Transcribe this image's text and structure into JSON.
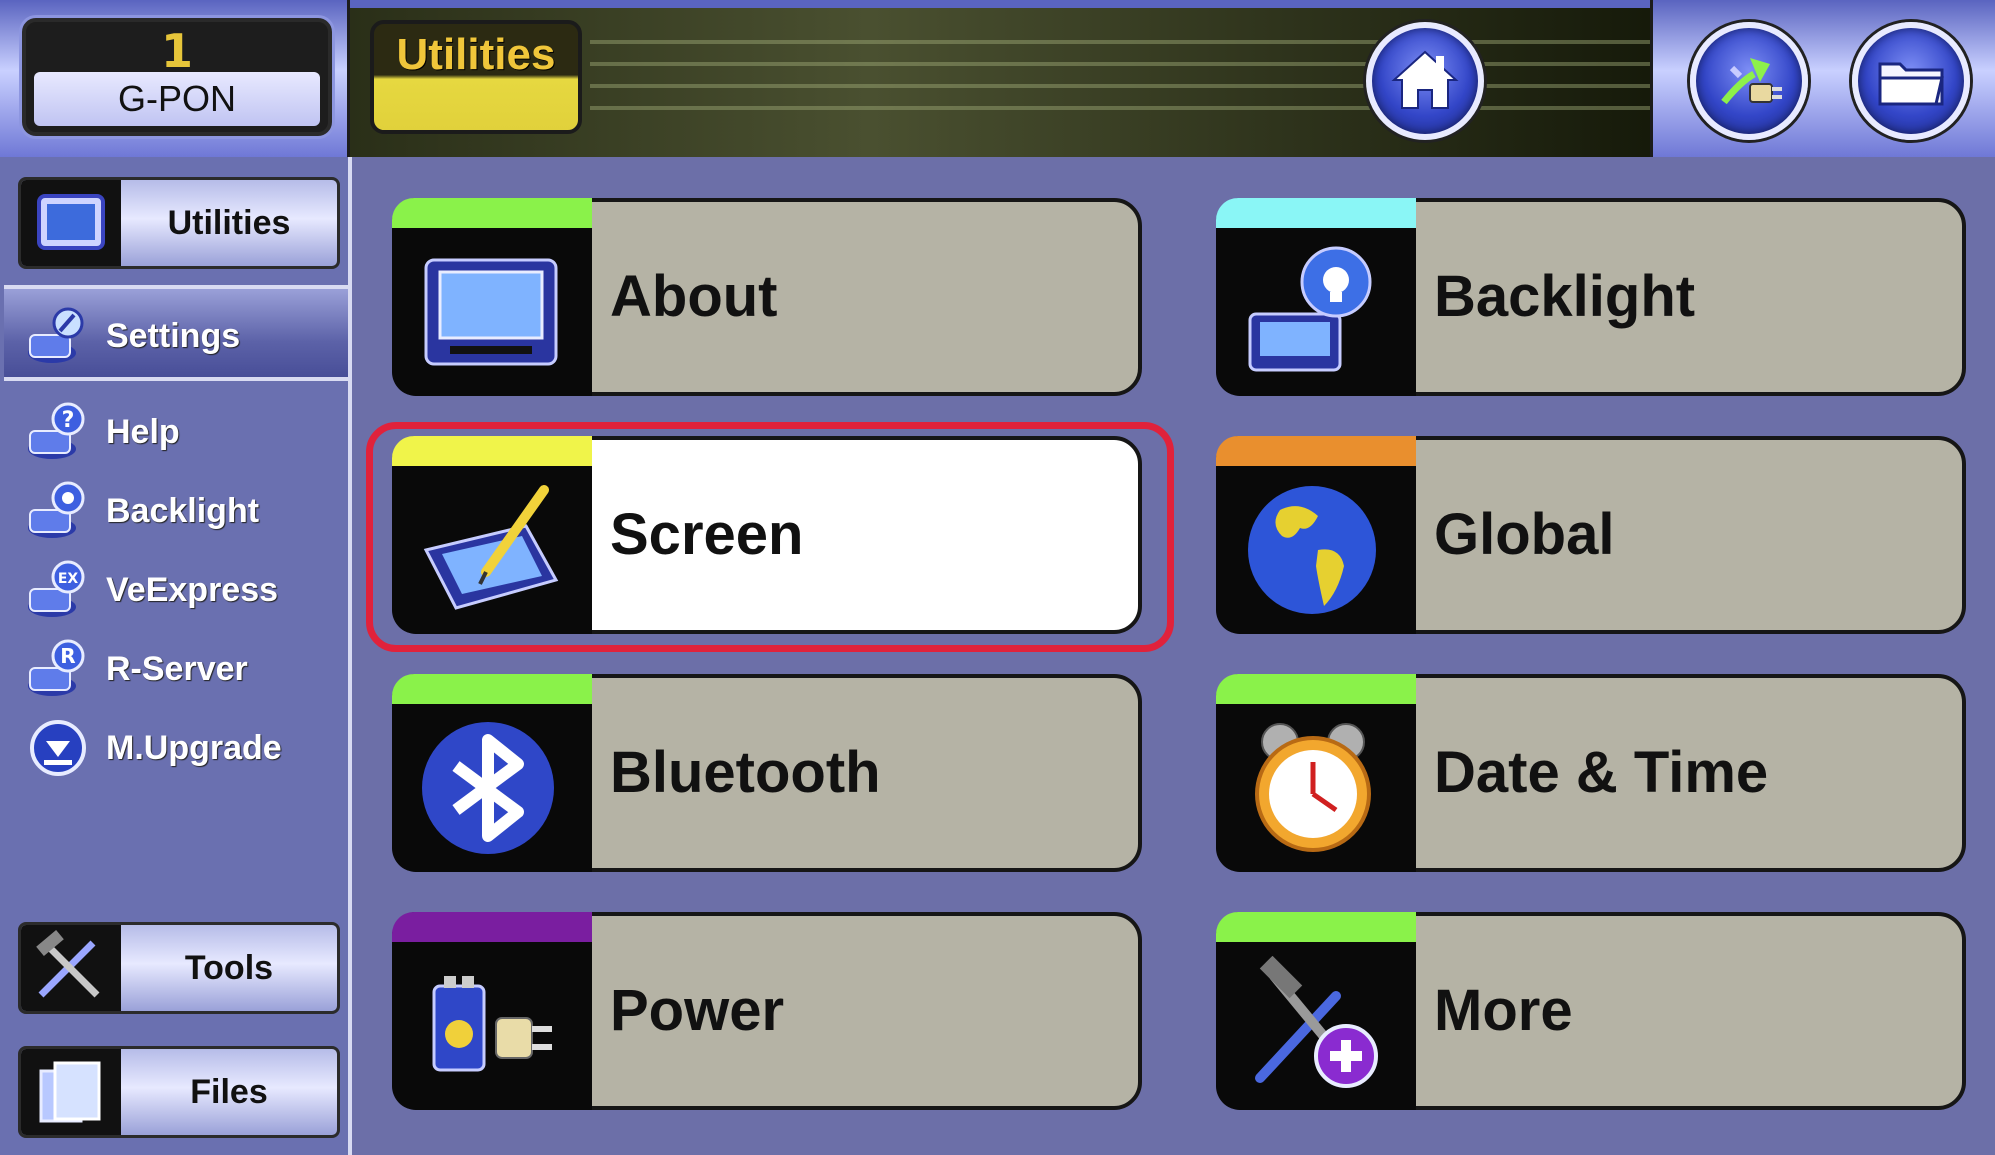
{
  "header": {
    "port_number": "1",
    "port_type": "G-PON",
    "title": "Utilities"
  },
  "sidebar": {
    "top_tile": "Utilities",
    "section": "Settings",
    "items": [
      "Help",
      "Backlight",
      "VeExpress",
      "R-Server",
      "M.Upgrade"
    ],
    "tiles": [
      "Tools",
      "Files"
    ]
  },
  "main": {
    "cards": [
      {
        "label": "About",
        "stripe": "#8af24a",
        "icon": "test-set-icon"
      },
      {
        "label": "Backlight",
        "stripe": "#8af6f6",
        "icon": "backlight-bulb-icon"
      },
      {
        "label": "Screen",
        "stripe": "#f0f44a",
        "icon": "touch-screen-pen-icon",
        "selected": true
      },
      {
        "label": "Global",
        "stripe": "#e98f2e",
        "icon": "globe-icon"
      },
      {
        "label": "Bluetooth",
        "stripe": "#8af24a",
        "icon": "bluetooth-icon"
      },
      {
        "label": "Date & Time",
        "stripe": "#8af24a",
        "icon": "alarm-clock-icon"
      },
      {
        "label": "Power",
        "stripe": "#7a1ea0",
        "icon": "battery-plug-icon"
      },
      {
        "label": "More",
        "stripe": "#8af24a",
        "icon": "tools-plus-icon"
      }
    ]
  },
  "colors": {
    "highlight": "#e0223b",
    "sidebar_bg": "#6a70b0",
    "main_bg": "#6c6fa8",
    "card_bg": "#b5b3a5"
  }
}
